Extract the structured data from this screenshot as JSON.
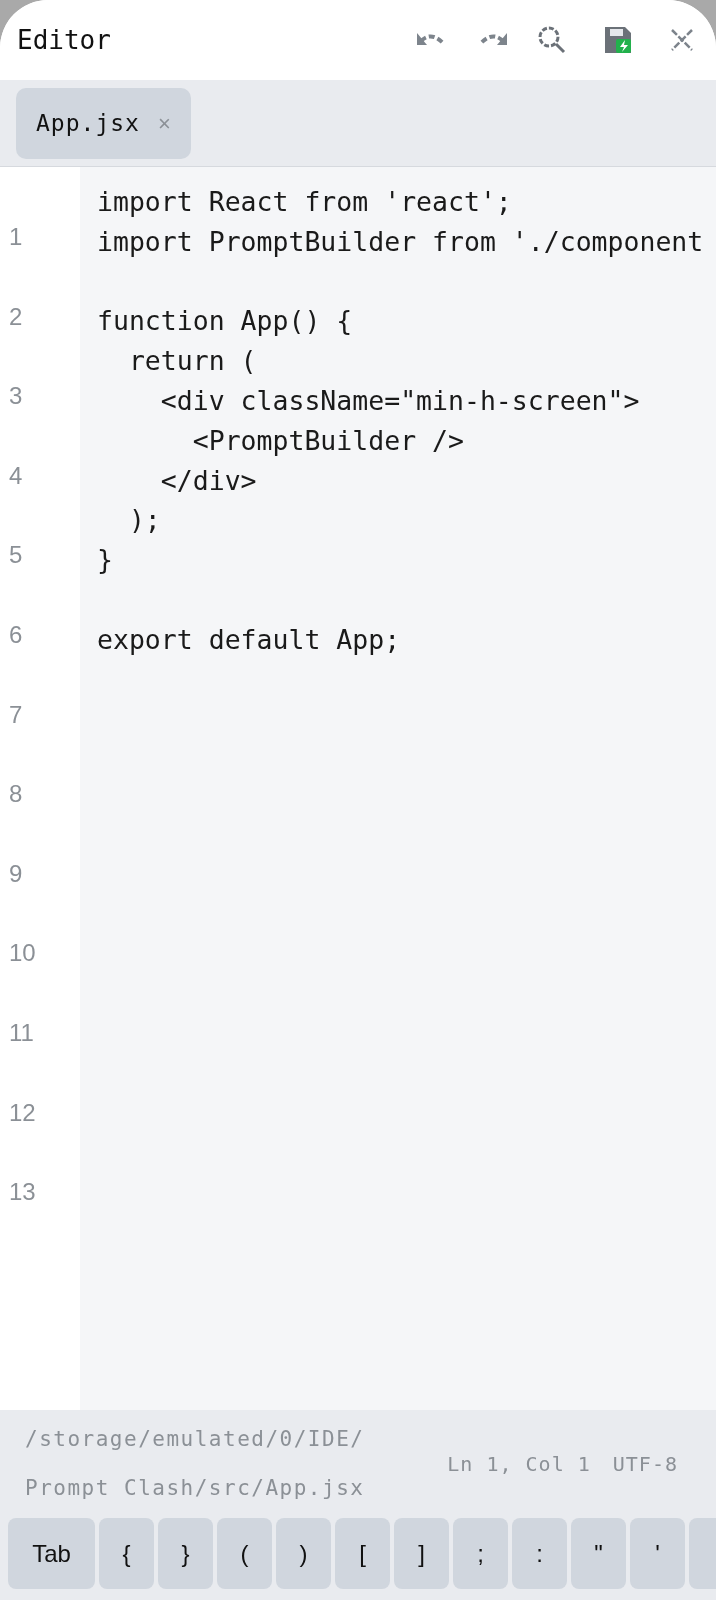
{
  "window": {
    "title": "Editor"
  },
  "tabs": [
    {
      "label": "App.jsx",
      "close": "×",
      "selected": true
    }
  ],
  "line_numbers": [
    "1",
    "2",
    "3",
    "4",
    "5",
    "6",
    "7",
    "8",
    "9",
    "10",
    "11",
    "12",
    "13"
  ],
  "code_lines": [
    {
      "kind": "code",
      "text": "import React from 'react';"
    },
    {
      "kind": "code",
      "text": "import PromptBuilder from './component"
    },
    {
      "kind": "blank"
    },
    {
      "kind": "code",
      "text": "function App() {"
    },
    {
      "kind": "code",
      "text": "  return ("
    },
    {
      "kind": "code",
      "text": "    <div className=\"min-h-screen\">"
    },
    {
      "kind": "code",
      "text": "      <PromptBuilder />"
    },
    {
      "kind": "code",
      "text": "    </div>"
    },
    {
      "kind": "code",
      "text": "  );"
    },
    {
      "kind": "code",
      "text": "}"
    },
    {
      "kind": "blank"
    },
    {
      "kind": "code",
      "text": "export default App;"
    }
  ],
  "status_bar": {
    "path": [
      "/storage/emulated/0/IDE/",
      "Prompt Clash/src/App.jsx"
    ],
    "position": "Ln 1, Col 1",
    "encoding": "UTF-8"
  },
  "keys": [
    "Tab",
    "{",
    "}",
    "(",
    ")",
    "[",
    "]",
    ";",
    ":",
    "\"",
    "'"
  ]
}
